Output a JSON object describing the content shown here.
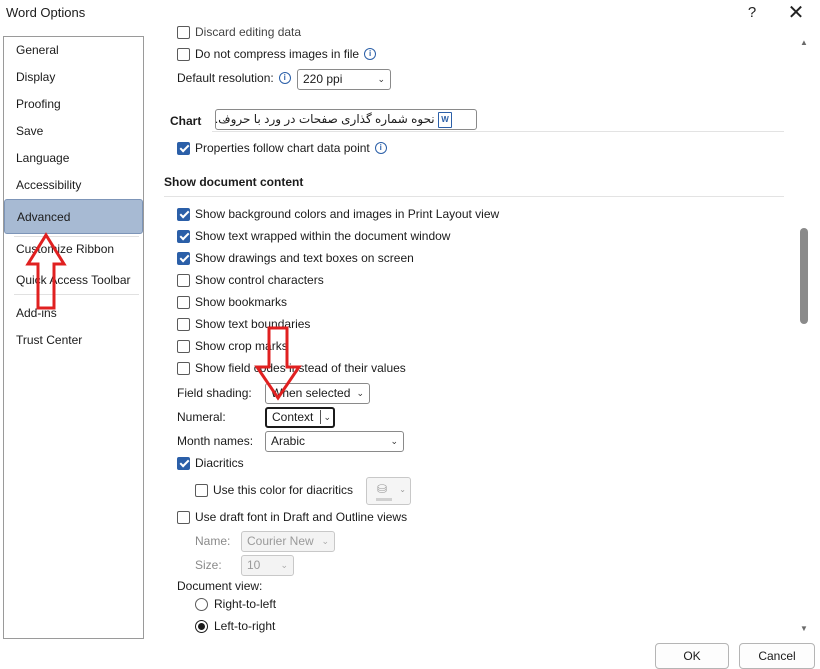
{
  "window": {
    "title": "Word Options",
    "help": "?",
    "close": "✕"
  },
  "nav": {
    "items": [
      {
        "label": "General"
      },
      {
        "label": "Display"
      },
      {
        "label": "Proofing"
      },
      {
        "label": "Save"
      },
      {
        "label": "Language"
      },
      {
        "label": "Accessibility"
      },
      {
        "label": "Advanced",
        "selected": true
      },
      {
        "label": "Customize Ribbon"
      },
      {
        "label": "Quick Access Toolbar"
      },
      {
        "label": "Add-ins"
      },
      {
        "label": "Trust Center"
      }
    ]
  },
  "image": {
    "discard_label": "Discard editing data",
    "compress_label": "Do not compress images in file",
    "resolution_label": "Default resolution:",
    "resolution_value": "220 ppi"
  },
  "chart": {
    "heading": "Chart",
    "document_value": "نحوه شماره گذاری صفحات در ورد با حروف...",
    "properties_label": "Properties follow chart data point"
  },
  "show_content": {
    "heading": "Show document content",
    "background_label": "Show background colors and images in Print Layout view",
    "wrapped_label": "Show text wrapped within the document window",
    "drawings_label": "Show drawings and text boxes on screen",
    "control_label": "Show control characters",
    "bookmarks_label": "Show bookmarks",
    "boundaries_label": "Show text boundaries",
    "crop_label": "Show crop marks",
    "field_codes_label": "Show field codes instead of their values",
    "field_shading_label": "Field shading:",
    "field_shading_value": "When selected",
    "numeral_label": "Numeral:",
    "numeral_value": "Context",
    "month_label": "Month names:",
    "month_value": "Arabic",
    "diacritics_label": "Diacritics",
    "diacritics_color_label": "Use this color for diacritics",
    "draft_font_label": "Use draft font in Draft and Outline views",
    "name_label": "Name:",
    "name_value": "Courier New",
    "size_label": "Size:",
    "size_value": "10",
    "doc_view_label": "Document view:",
    "rtl_label": "Right-to-left",
    "ltr_label": "Left-to-right"
  },
  "buttons": {
    "ok": "OK",
    "cancel": "Cancel"
  },
  "colors": {
    "accent": "#2b5fa8",
    "selected_nav": "#a7bad3",
    "annotation_arrow": "#e02020"
  }
}
